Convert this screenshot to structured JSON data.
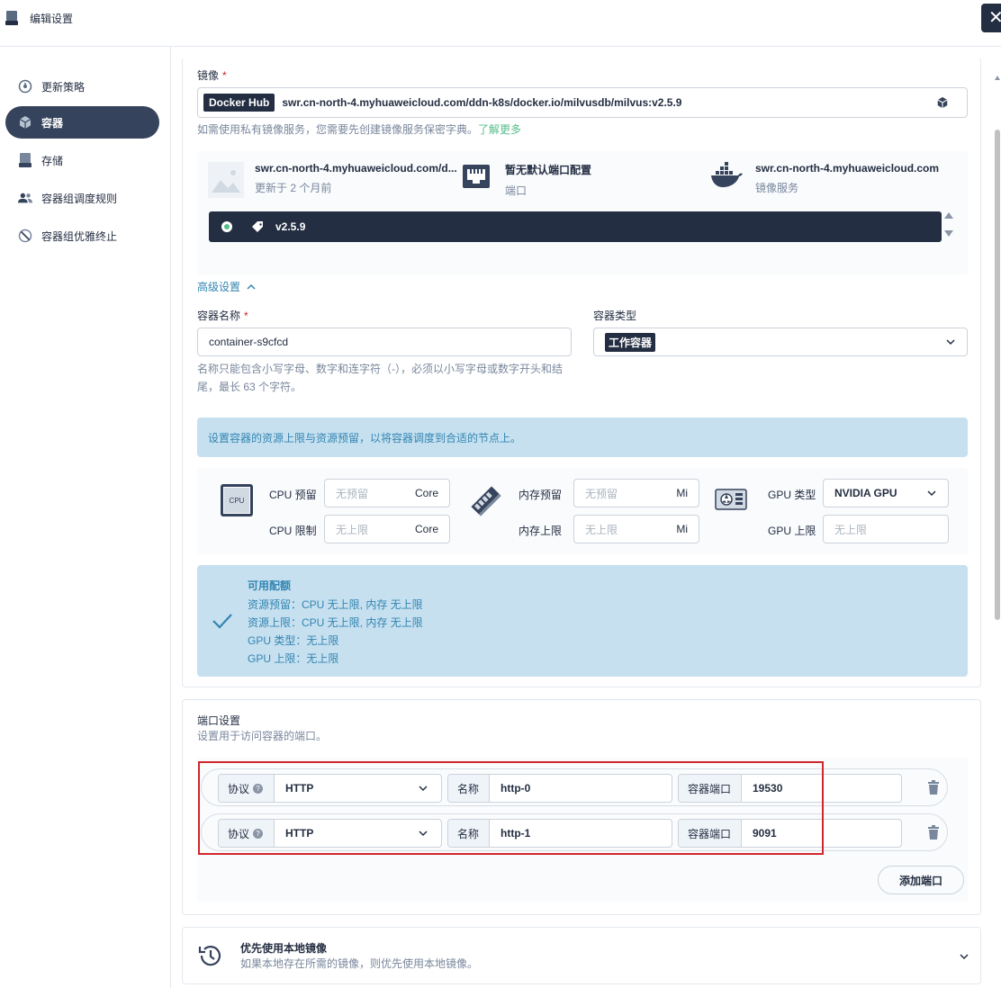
{
  "header": {
    "title": "编辑设置",
    "close_label": "✕"
  },
  "sidebar": {
    "items": [
      {
        "label": "更新策略",
        "icon": "update-strategy-icon",
        "active": false
      },
      {
        "label": "容器",
        "icon": "container-icon",
        "active": true
      },
      {
        "label": "存储",
        "icon": "storage-icon",
        "active": false
      },
      {
        "label": "容器组调度规则",
        "icon": "pod-schedule-icon",
        "active": false
      },
      {
        "label": "容器组优雅终止",
        "icon": "graceful-terminate-icon",
        "active": false
      }
    ]
  },
  "image": {
    "label": "镜像",
    "registry_tag": "Docker Hub",
    "value": "swr.cn-north-4.myhuaweicloud.com/ddn-k8s/docker.io/milvusdb/milvus:v2.5.9",
    "tip_prefix": "如需使用私有镜像服务，您需要先创建镜像服务保密字典。",
    "tip_link": "了解更多",
    "info": [
      {
        "title": "swr.cn-north-4.myhuaweicloud.com/d...",
        "sub": "更新于 2 个月前"
      },
      {
        "title": "暂无默认端口配置",
        "sub": "端口"
      },
      {
        "title": "swr.cn-north-4.myhuaweicloud.com",
        "sub": "镜像服务"
      }
    ],
    "selected_tag": "v2.5.9"
  },
  "advanced": {
    "label": "高级设置"
  },
  "container": {
    "name_label": "容器名称",
    "name_value": "container-s9cfcd",
    "name_tip_line1": "名称只能包含小写字母、数字和连字符（-），必须以小写字母或数字开头和结",
    "name_tip_line2": "尾，最长 63 个字符。",
    "type_label": "容器类型",
    "type_value": "工作容器"
  },
  "resources": {
    "tip": "设置容器的资源上限与资源预留，以将容器调度到合适的节点上。",
    "cpu_icon_text": "CPU",
    "cpu_request_label": "CPU 预留",
    "cpu_request_placeholder": "无预留",
    "cpu_limit_label": "CPU 限制",
    "cpu_limit_placeholder": "无上限",
    "cpu_unit": "Core",
    "mem_request_label": "内存预留",
    "mem_request_placeholder": "无预留",
    "mem_limit_label": "内存上限",
    "mem_limit_placeholder": "无上限",
    "mem_unit": "Mi",
    "gpu_type_label": "GPU 类型",
    "gpu_type_value": "NVIDIA GPU",
    "gpu_limit_label": "GPU 上限",
    "gpu_limit_placeholder": "无上限"
  },
  "quota": {
    "title": "可用配额",
    "lines": [
      "资源预留：CPU 无上限, 内存 无上限",
      "资源上限：CPU 无上限, 内存 无上限",
      "GPU 类型：无上限",
      "GPU 上限：无上限"
    ]
  },
  "ports": {
    "title": "端口设置",
    "desc": "设置用于访问容器的端口。",
    "protocol_label": "协议",
    "name_label": "名称",
    "port_label": "容器端口",
    "rows": [
      {
        "protocol": "HTTP",
        "name": "http-0",
        "port": "19530"
      },
      {
        "protocol": "HTTP",
        "name": "http-1",
        "port": "9091"
      }
    ],
    "add_label": "添加端口"
  },
  "local_image": {
    "title": "优先使用本地镜像",
    "desc": "如果本地存在所需的镜像，则优先使用本地镜像。"
  }
}
